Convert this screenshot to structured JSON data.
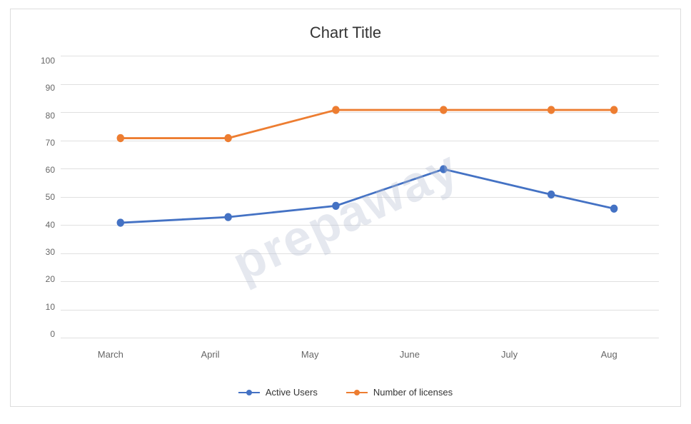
{
  "chart": {
    "title": "Chart Title",
    "watermark": "prepaway",
    "yAxis": {
      "labels": [
        "0",
        "10",
        "20",
        "30",
        "40",
        "50",
        "60",
        "70",
        "80",
        "90",
        "100"
      ],
      "min": 0,
      "max": 100,
      "step": 10
    },
    "xAxis": {
      "labels": [
        "March",
        "April",
        "May",
        "June",
        "July",
        "Aug"
      ]
    },
    "series": [
      {
        "name": "Active Users",
        "color": "#4472C4",
        "data": [
          41,
          43,
          47,
          60,
          51,
          46
        ]
      },
      {
        "name": "Number of licenses",
        "color": "#ED7D31",
        "data": [
          71,
          71,
          81,
          81,
          81,
          81
        ]
      }
    ]
  }
}
